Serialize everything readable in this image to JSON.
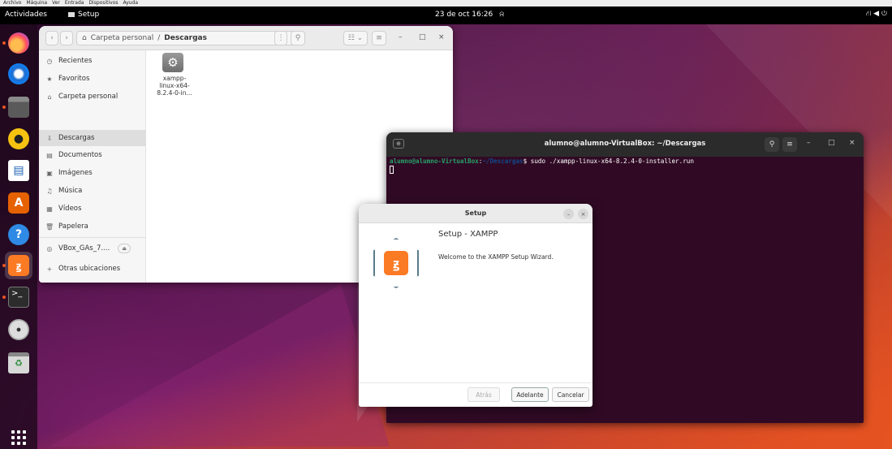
{
  "vbox_menu": [
    "Archivo",
    "Máquina",
    "Ver",
    "Entrada",
    "Dispositivos",
    "Ayuda"
  ],
  "topbar": {
    "activities": "Actividades",
    "app_name": "Setup",
    "clock": "23 de oct  16:26",
    "tray": "⛙ ◀ ⏻"
  },
  "files": {
    "path_home": "Carpeta personal",
    "path_current": "Descargas",
    "sidebar": [
      {
        "icon": "clock-icon",
        "glyph": "◷",
        "label": "Recientes"
      },
      {
        "icon": "star-icon",
        "glyph": "★",
        "label": "Favoritos"
      },
      {
        "icon": "home-icon",
        "glyph": "⌂",
        "label": "Carpeta personal"
      },
      {
        "icon": "download-icon",
        "glyph": "⇩",
        "label": "Descargas",
        "active": true
      },
      {
        "icon": "document-icon",
        "glyph": "▤",
        "label": "Documentos"
      },
      {
        "icon": "image-icon",
        "glyph": "▣",
        "label": "Imágenes"
      },
      {
        "icon": "music-icon",
        "glyph": "♫",
        "label": "Música"
      },
      {
        "icon": "video-icon",
        "glyph": "▦",
        "label": "Vídeos"
      },
      {
        "icon": "trash-icon",
        "glyph": "🗑",
        "label": "Papelera"
      },
      {
        "icon": "disc-icon",
        "glyph": "◎",
        "label": "VBox_GAs_7...."
      },
      {
        "icon": "plus-icon",
        "glyph": "+",
        "label": "Otras ubicaciones"
      }
    ],
    "file_label": "xampp-\nlinux-x64-\n8.2.4-0-in..."
  },
  "terminal": {
    "title": "alumno@alumno-VirtualBox: ~/Descargas",
    "prompt_user": "alumno@alumno-VirtualBox",
    "prompt_path": "~/Descargas",
    "command": "$ sudo ./xampp-linux-x64-8.2.4-0-installer.run"
  },
  "setup": {
    "title": "Setup",
    "heading": "Setup - XAMPP",
    "welcome": "Welcome to the XAMPP Setup Wizard.",
    "btn_back": "Atrás",
    "btn_next": "Adelante",
    "btn_cancel": "Cancelar"
  },
  "colors": {
    "accent": "#e95420",
    "terminal_bg": "#300a24",
    "xampp_orange": "#fb7a24"
  }
}
